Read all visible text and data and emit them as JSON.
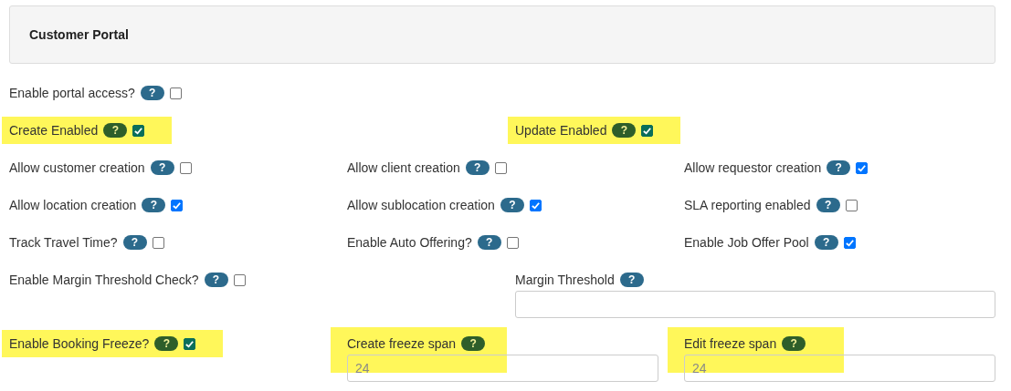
{
  "panel": {
    "title": "Customer Portal"
  },
  "help_badge": "?",
  "rows": [
    {
      "kind": "halves",
      "items": [
        {
          "kind": "checkbox",
          "label": "Enable portal access?",
          "checked": false,
          "highlighted": false
        }
      ]
    },
    {
      "kind": "halves",
      "items": [
        {
          "kind": "checkbox",
          "label": "Create Enabled",
          "checked": true,
          "highlighted": true
        },
        {
          "kind": "checkbox",
          "label": "Update Enabled",
          "checked": true,
          "highlighted": true
        }
      ]
    },
    {
      "kind": "thirds",
      "items": [
        {
          "kind": "checkbox",
          "label": "Allow customer creation",
          "checked": false,
          "highlighted": false
        },
        {
          "kind": "checkbox",
          "label": "Allow client creation",
          "checked": false,
          "highlighted": false
        },
        {
          "kind": "checkbox",
          "label": "Allow requestor creation",
          "checked": true,
          "highlighted": false
        }
      ]
    },
    {
      "kind": "thirds",
      "items": [
        {
          "kind": "checkbox",
          "label": "Allow location creation",
          "checked": true,
          "highlighted": false
        },
        {
          "kind": "checkbox",
          "label": "Allow sublocation creation",
          "checked": true,
          "highlighted": false
        },
        {
          "kind": "checkbox",
          "label": "SLA reporting enabled",
          "checked": false,
          "highlighted": false
        }
      ]
    },
    {
      "kind": "thirds",
      "items": [
        {
          "kind": "checkbox",
          "label": "Track Travel Time?",
          "checked": false,
          "highlighted": false
        },
        {
          "kind": "checkbox",
          "label": "Enable Auto Offering?",
          "checked": false,
          "highlighted": false
        },
        {
          "kind": "checkbox",
          "label": "Enable Job Offer Pool",
          "checked": true,
          "highlighted": false
        }
      ]
    },
    {
      "kind": "halves",
      "items": [
        {
          "kind": "checkbox",
          "label": "Enable Margin Threshold Check?",
          "checked": false,
          "highlighted": false
        },
        {
          "kind": "field",
          "label": "Margin Threshold",
          "highlighted": false
        }
      ]
    },
    {
      "kind": "thirds",
      "items": [
        {
          "kind": "checkbox",
          "label": "Enable Booking Freeze?",
          "checked": true,
          "highlighted": true
        },
        {
          "kind": "field",
          "label": "Create freeze span",
          "placeholder": "24",
          "highlighted": true
        },
        {
          "kind": "field",
          "label": "Edit freeze span",
          "placeholder": "24",
          "highlighted": true
        }
      ]
    }
  ]
}
